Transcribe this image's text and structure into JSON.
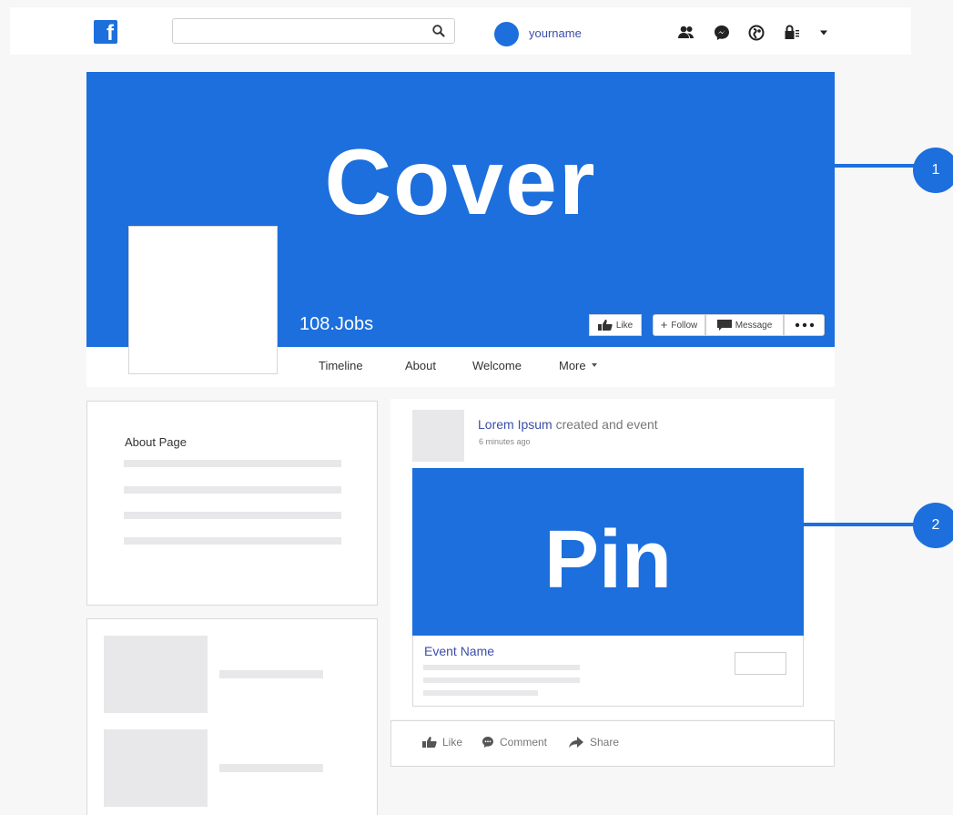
{
  "topbar": {
    "search_placeholder": "",
    "username": "yourname"
  },
  "cover": {
    "label": "Cover",
    "page_name": "108.Jobs",
    "buttons": {
      "like": "Like",
      "follow": "Follow",
      "message": "Message"
    }
  },
  "tabs": [
    "Timeline",
    "About",
    "Welcome",
    "More"
  ],
  "about_card": {
    "title": "About Page"
  },
  "post": {
    "author": "Lorem Ipsum",
    "action_text": "created and event",
    "time": "6 minutes ago",
    "pin_label": "Pin",
    "event_name": "Event Name",
    "actions": [
      "Like",
      "Comment",
      "Share"
    ]
  },
  "callouts": [
    "1",
    "2"
  ],
  "colors": {
    "brand": "#1c6fdc",
    "text_link": "#3b4ea8",
    "placeholder": "#e8e8ea"
  }
}
